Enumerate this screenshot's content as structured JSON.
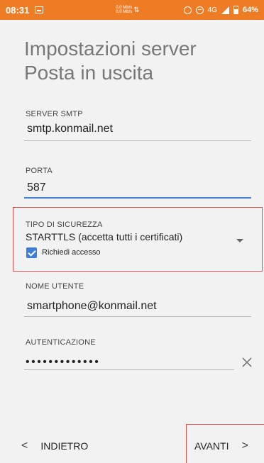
{
  "status_bar": {
    "time": "08:31",
    "speed_up": "0,0 Mb/s",
    "speed_down": "0,0 Mb/s",
    "network": "4G",
    "battery": "64%"
  },
  "page": {
    "title": "Impostazioni server Posta in uscita"
  },
  "fields": {
    "smtp_server": {
      "label": "SERVER SMTP",
      "value": "smtp.konmail.net"
    },
    "port": {
      "label": "PORTA",
      "value": "587"
    },
    "security": {
      "label": "TIPO DI SICUREZZA",
      "value": "STARTTLS (accetta tutti i certificati)"
    },
    "require_login": {
      "label": "Richiedi accesso",
      "checked": true
    },
    "username": {
      "label": "NOME UTENTE",
      "value": "smartphone@konmail.net"
    },
    "authentication": {
      "label": "AUTENTICAZIONE",
      "value": "•••••••••••••"
    }
  },
  "navigation": {
    "back_label": "INDIETRO",
    "next_label": "AVANTI"
  },
  "colors": {
    "status_bar": "#ee7c24",
    "accent": "#3f7ed8",
    "highlight_box": "#e05252"
  }
}
